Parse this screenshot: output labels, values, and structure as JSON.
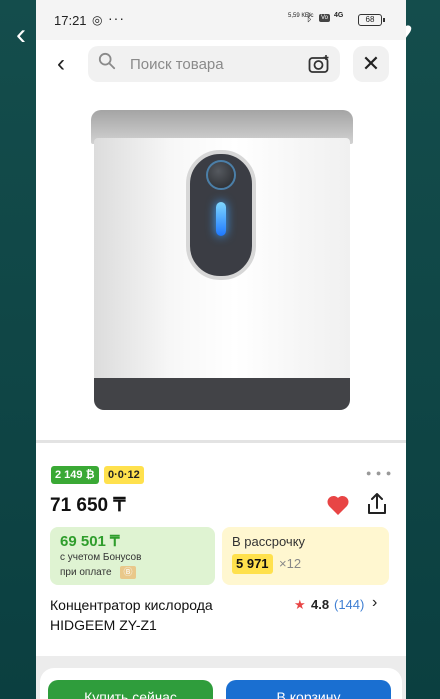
{
  "status_bar": {
    "time": "17:21",
    "net_speed": "5,59 КБ/с",
    "network": "4G",
    "battery": "68"
  },
  "search": {
    "placeholder": "Поиск товара"
  },
  "badges": {
    "green": "2 149 ₿",
    "installment": "0·0·12"
  },
  "price": "71 650 ₸",
  "bonus_card": {
    "amount": "69 501 ₸",
    "line1": "с учетом Бонусов",
    "line2": "при оплате"
  },
  "installment_card": {
    "title": "В рассрочку",
    "amount": "5 971",
    "months": "×12"
  },
  "product": {
    "name_line1": "Концентратор кислорода",
    "name_line2": "HIDGEEM ZY-Z1"
  },
  "rating": {
    "value": "4.8",
    "count": "(144)"
  },
  "buttons": {
    "buy_now": "Купить сейчас",
    "add_to_cart": "В корзину"
  },
  "colors": {
    "green": "#2f9d3c",
    "blue": "#1a6fd1",
    "yellow": "#ffe14d",
    "heart": "#e84545"
  }
}
